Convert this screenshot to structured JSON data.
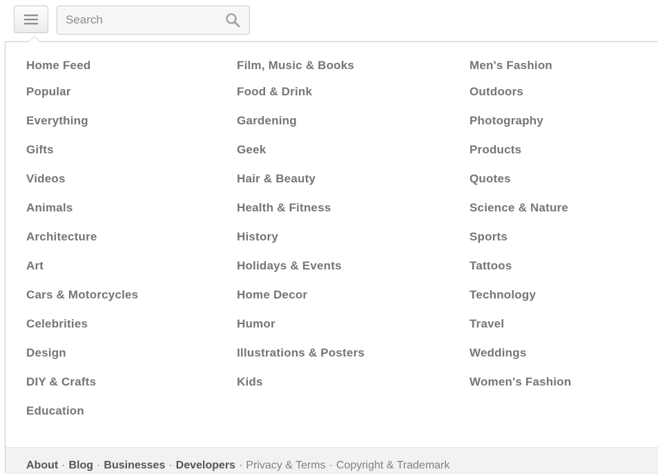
{
  "header": {
    "menu_icon": "hamburger-menu-icon",
    "search": {
      "placeholder": "Search",
      "value": "",
      "icon": "search-icon"
    }
  },
  "categories": {
    "column1": [
      "Home Feed",
      "Popular",
      "Everything",
      "Gifts",
      "Videos",
      "Animals",
      "Architecture",
      "Art",
      "Cars & Motorcycles",
      "Celebrities",
      "Design",
      "DIY & Crafts",
      "Education"
    ],
    "column2": [
      "Film, Music & Books",
      "Food & Drink",
      "Gardening",
      "Geek",
      "Hair & Beauty",
      "Health & Fitness",
      "History",
      "Holidays & Events",
      "Home Decor",
      "Humor",
      "Illustrations & Posters",
      "Kids"
    ],
    "column3": [
      "Men's Fashion",
      "Outdoors",
      "Photography",
      "Products",
      "Quotes",
      "Science & Nature",
      "Sports",
      "Tattoos",
      "Technology",
      "Travel",
      "Weddings",
      "Women's Fashion"
    ]
  },
  "footer": {
    "about": "About",
    "blog": "Blog",
    "businesses": "Businesses",
    "developers": "Developers",
    "privacy": "Privacy & Terms",
    "copyright": "Copyright & Trademark",
    "separator": "·"
  },
  "colors": {
    "category_text": "#757575",
    "footer_bg": "#f2f2f2",
    "border": "#c9c9c9"
  }
}
